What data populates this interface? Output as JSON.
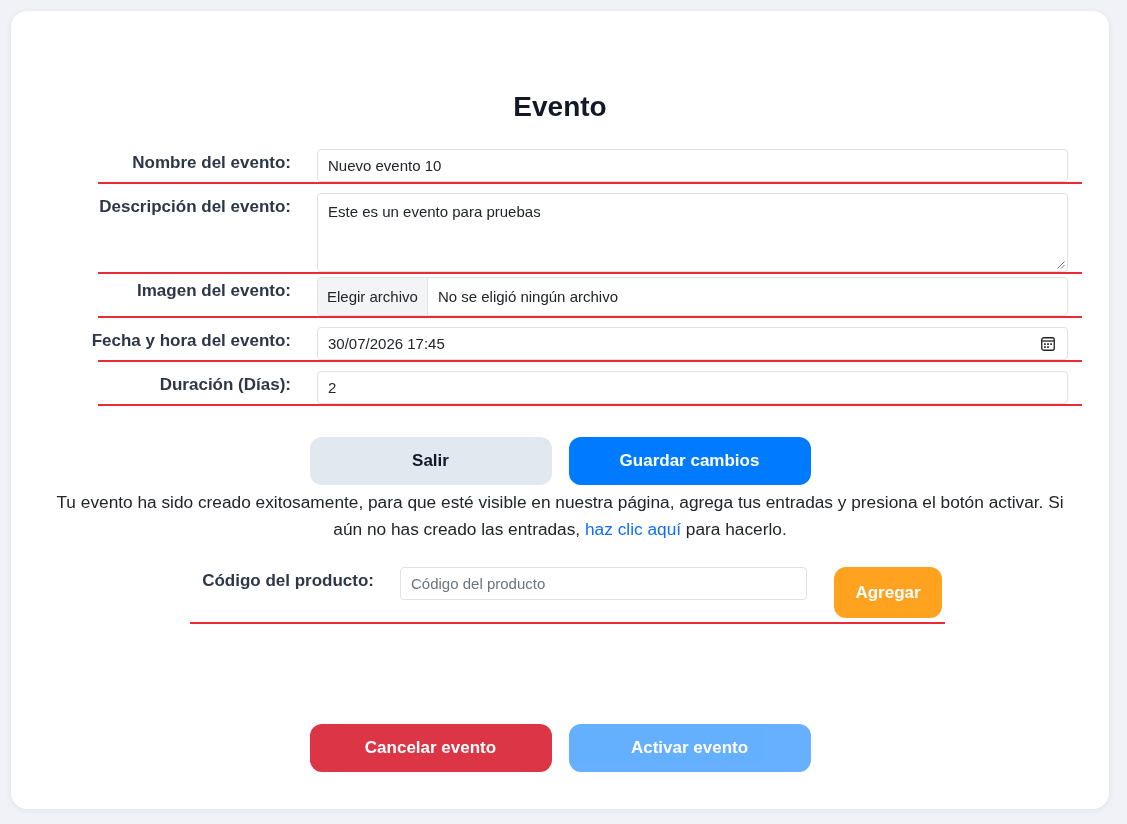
{
  "title": "Evento",
  "fields": [
    {
      "kind": "text",
      "label": "Nombre del evento:",
      "value": "Nuevo evento 10"
    },
    {
      "kind": "textarea",
      "label": "Descripción del evento:",
      "value": "Este es un evento para pruebas"
    },
    {
      "kind": "file",
      "label": "Imagen del evento:",
      "button": "Elegir archivo",
      "status": "No se eligió ningún archivo"
    },
    {
      "kind": "datetime",
      "label": "Fecha y hora del evento:",
      "value": "30/07/2026 17:45"
    },
    {
      "kind": "number",
      "label": "Duración (Días):",
      "value": "2"
    }
  ],
  "actions": [
    {
      "kind": "secondary",
      "label": "Salir"
    },
    {
      "kind": "primary",
      "label": "Guardar cambios"
    }
  ],
  "message": {
    "before": "Tu evento ha sido creado exitosamente, para que esté visible en nuestra página, agrega tus entradas y presiona el botón activar. Si aún no has creado las entradas, ",
    "link": "haz clic aquí",
    "after": " para hacerlo."
  },
  "product": {
    "label": "Código del producto:",
    "placeholder": "Código del producto",
    "button": "Agregar"
  },
  "footer_actions": [
    {
      "kind": "danger",
      "label": "Cancelar evento",
      "disabled": false
    },
    {
      "kind": "primary",
      "label": "Activar evento",
      "disabled": true
    }
  ]
}
